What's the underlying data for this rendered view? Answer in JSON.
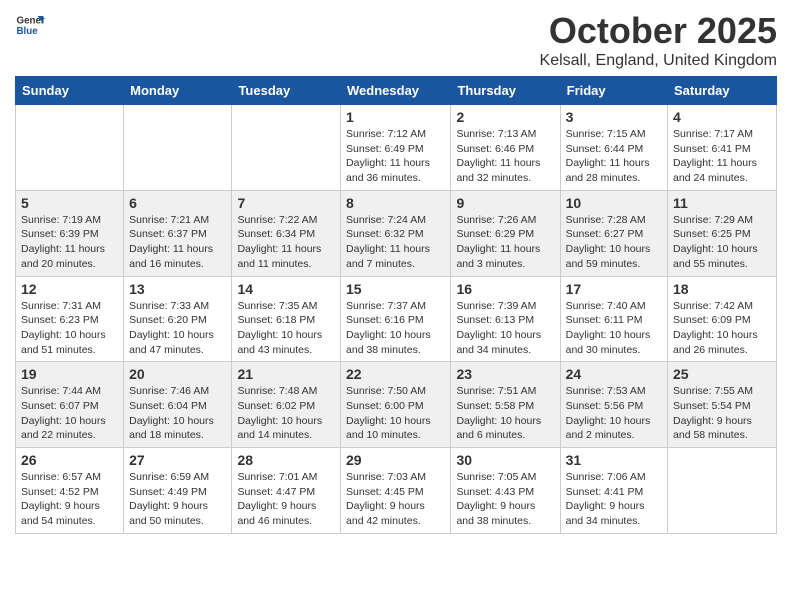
{
  "header": {
    "logo_general": "General",
    "logo_blue": "Blue",
    "month": "October 2025",
    "location": "Kelsall, England, United Kingdom"
  },
  "weekdays": [
    "Sunday",
    "Monday",
    "Tuesday",
    "Wednesday",
    "Thursday",
    "Friday",
    "Saturday"
  ],
  "weeks": [
    [
      {
        "day": "",
        "info": ""
      },
      {
        "day": "",
        "info": ""
      },
      {
        "day": "",
        "info": ""
      },
      {
        "day": "1",
        "info": "Sunrise: 7:12 AM\nSunset: 6:49 PM\nDaylight: 11 hours\nand 36 minutes."
      },
      {
        "day": "2",
        "info": "Sunrise: 7:13 AM\nSunset: 6:46 PM\nDaylight: 11 hours\nand 32 minutes."
      },
      {
        "day": "3",
        "info": "Sunrise: 7:15 AM\nSunset: 6:44 PM\nDaylight: 11 hours\nand 28 minutes."
      },
      {
        "day": "4",
        "info": "Sunrise: 7:17 AM\nSunset: 6:41 PM\nDaylight: 11 hours\nand 24 minutes."
      }
    ],
    [
      {
        "day": "5",
        "info": "Sunrise: 7:19 AM\nSunset: 6:39 PM\nDaylight: 11 hours\nand 20 minutes."
      },
      {
        "day": "6",
        "info": "Sunrise: 7:21 AM\nSunset: 6:37 PM\nDaylight: 11 hours\nand 16 minutes."
      },
      {
        "day": "7",
        "info": "Sunrise: 7:22 AM\nSunset: 6:34 PM\nDaylight: 11 hours\nand 11 minutes."
      },
      {
        "day": "8",
        "info": "Sunrise: 7:24 AM\nSunset: 6:32 PM\nDaylight: 11 hours\nand 7 minutes."
      },
      {
        "day": "9",
        "info": "Sunrise: 7:26 AM\nSunset: 6:29 PM\nDaylight: 11 hours\nand 3 minutes."
      },
      {
        "day": "10",
        "info": "Sunrise: 7:28 AM\nSunset: 6:27 PM\nDaylight: 10 hours\nand 59 minutes."
      },
      {
        "day": "11",
        "info": "Sunrise: 7:29 AM\nSunset: 6:25 PM\nDaylight: 10 hours\nand 55 minutes."
      }
    ],
    [
      {
        "day": "12",
        "info": "Sunrise: 7:31 AM\nSunset: 6:23 PM\nDaylight: 10 hours\nand 51 minutes."
      },
      {
        "day": "13",
        "info": "Sunrise: 7:33 AM\nSunset: 6:20 PM\nDaylight: 10 hours\nand 47 minutes."
      },
      {
        "day": "14",
        "info": "Sunrise: 7:35 AM\nSunset: 6:18 PM\nDaylight: 10 hours\nand 43 minutes."
      },
      {
        "day": "15",
        "info": "Sunrise: 7:37 AM\nSunset: 6:16 PM\nDaylight: 10 hours\nand 38 minutes."
      },
      {
        "day": "16",
        "info": "Sunrise: 7:39 AM\nSunset: 6:13 PM\nDaylight: 10 hours\nand 34 minutes."
      },
      {
        "day": "17",
        "info": "Sunrise: 7:40 AM\nSunset: 6:11 PM\nDaylight: 10 hours\nand 30 minutes."
      },
      {
        "day": "18",
        "info": "Sunrise: 7:42 AM\nSunset: 6:09 PM\nDaylight: 10 hours\nand 26 minutes."
      }
    ],
    [
      {
        "day": "19",
        "info": "Sunrise: 7:44 AM\nSunset: 6:07 PM\nDaylight: 10 hours\nand 22 minutes."
      },
      {
        "day": "20",
        "info": "Sunrise: 7:46 AM\nSunset: 6:04 PM\nDaylight: 10 hours\nand 18 minutes."
      },
      {
        "day": "21",
        "info": "Sunrise: 7:48 AM\nSunset: 6:02 PM\nDaylight: 10 hours\nand 14 minutes."
      },
      {
        "day": "22",
        "info": "Sunrise: 7:50 AM\nSunset: 6:00 PM\nDaylight: 10 hours\nand 10 minutes."
      },
      {
        "day": "23",
        "info": "Sunrise: 7:51 AM\nSunset: 5:58 PM\nDaylight: 10 hours\nand 6 minutes."
      },
      {
        "day": "24",
        "info": "Sunrise: 7:53 AM\nSunset: 5:56 PM\nDaylight: 10 hours\nand 2 minutes."
      },
      {
        "day": "25",
        "info": "Sunrise: 7:55 AM\nSunset: 5:54 PM\nDaylight: 9 hours\nand 58 minutes."
      }
    ],
    [
      {
        "day": "26",
        "info": "Sunrise: 6:57 AM\nSunset: 4:52 PM\nDaylight: 9 hours\nand 54 minutes."
      },
      {
        "day": "27",
        "info": "Sunrise: 6:59 AM\nSunset: 4:49 PM\nDaylight: 9 hours\nand 50 minutes."
      },
      {
        "day": "28",
        "info": "Sunrise: 7:01 AM\nSunset: 4:47 PM\nDaylight: 9 hours\nand 46 minutes."
      },
      {
        "day": "29",
        "info": "Sunrise: 7:03 AM\nSunset: 4:45 PM\nDaylight: 9 hours\nand 42 minutes."
      },
      {
        "day": "30",
        "info": "Sunrise: 7:05 AM\nSunset: 4:43 PM\nDaylight: 9 hours\nand 38 minutes."
      },
      {
        "day": "31",
        "info": "Sunrise: 7:06 AM\nSunset: 4:41 PM\nDaylight: 9 hours\nand 34 minutes."
      },
      {
        "day": "",
        "info": ""
      }
    ]
  ]
}
